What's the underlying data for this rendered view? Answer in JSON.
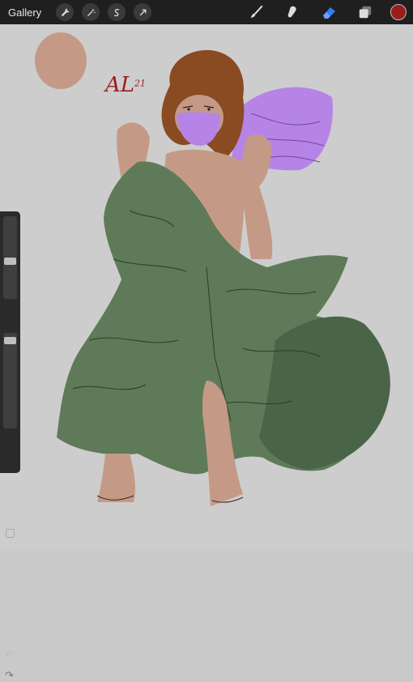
{
  "topbar": {
    "gallery_label": "Gallery",
    "actions": [
      {
        "icon": "wrench-icon",
        "name": "actions-button"
      },
      {
        "icon": "magic-wand-icon",
        "name": "adjustments-button"
      },
      {
        "icon": "selection-s-icon",
        "name": "selection-button"
      },
      {
        "icon": "arrow-cursor-icon",
        "name": "transform-button"
      }
    ],
    "tools": {
      "brush": "brush-icon",
      "smudge": "smudge-icon",
      "eraser": "eraser-icon",
      "layers": "layers-icon"
    },
    "active_tool": "eraser",
    "active_color": "#9b1d1b"
  },
  "colors": {
    "toolbar_bg": "#1f1f1f",
    "canvas_bg": "#cdcdcd",
    "active_tool_blue": "#2f7cf6",
    "skin": "#c49a86",
    "dress_green": "#5f7a59",
    "dress_dark_green": "#4a6447",
    "hair_brown": "#8a4a22",
    "purple": "#b684e6",
    "signature_red": "#9b1d1b"
  },
  "artwork": {
    "signature": "AL",
    "signature_year": "21"
  },
  "sidebar": {
    "brush_size_level": 0.45,
    "opacity_level": 0.95,
    "undo_icon": "undo-icon",
    "redo_icon": "redo-icon",
    "modify_icon": "square-icon"
  }
}
